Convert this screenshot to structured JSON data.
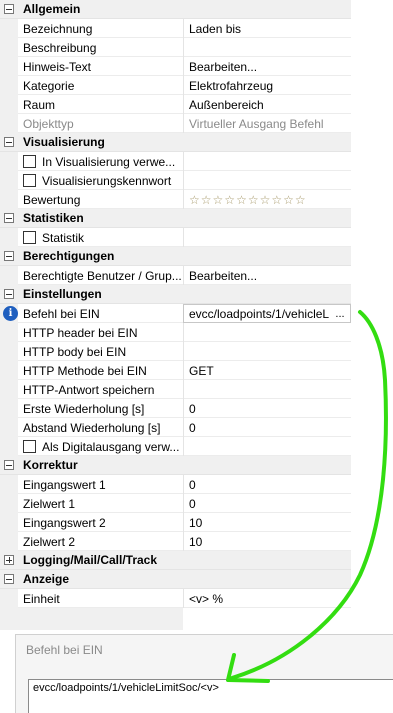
{
  "sections": [
    {
      "title": "Allgemein",
      "rows": [
        {
          "name": "Bezeichnung",
          "value": "Laden bis"
        },
        {
          "name": "Beschreibung",
          "value": ""
        },
        {
          "name": "Hinweis-Text",
          "value": "Bearbeiten..."
        },
        {
          "name": "Kategorie",
          "value": "Elektrofahrzeug"
        },
        {
          "name": "Raum",
          "value": "Außenbereich"
        },
        {
          "name": "Objekttyp",
          "value": "Virtueller Ausgang Befehl"
        }
      ]
    },
    {
      "title": "Visualisierung",
      "rows": [
        {
          "name": "In Visualisierung verwe...",
          "value": ""
        },
        {
          "name": "Visualisierungskennwort",
          "value": ""
        },
        {
          "name": "Bewertung",
          "value": ""
        }
      ]
    },
    {
      "title": "Statistiken",
      "rows": [
        {
          "name": "Statistik",
          "value": ""
        }
      ]
    },
    {
      "title": "Berechtigungen",
      "rows": [
        {
          "name": "Berechtigte Benutzer / Grup...",
          "value": "Bearbeiten..."
        }
      ]
    },
    {
      "title": "Einstellungen",
      "rows": [
        {
          "name": "Befehl bei EIN",
          "value": "evcc/loadpoints/1/vehicleL",
          "button": "..."
        },
        {
          "name": "HTTP header bei EIN",
          "value": ""
        },
        {
          "name": "HTTP body bei EIN",
          "value": ""
        },
        {
          "name": "HTTP Methode bei EIN",
          "value": "GET"
        },
        {
          "name": "HTTP-Antwort speichern",
          "value": ""
        },
        {
          "name": "Erste Wiederholung [s]",
          "value": "0"
        },
        {
          "name": "Abstand Wiederholung [s]",
          "value": "0"
        },
        {
          "name": "Als Digitalausgang verw...",
          "value": ""
        }
      ]
    },
    {
      "title": "Korrektur",
      "rows": [
        {
          "name": "Eingangswert 1",
          "value": "0"
        },
        {
          "name": "Zielwert 1",
          "value": "0"
        },
        {
          "name": "Eingangswert 2",
          "value": "10"
        },
        {
          "name": "Zielwert 2",
          "value": "10"
        }
      ]
    },
    {
      "title": "Logging/Mail/Call/Track",
      "rows": []
    },
    {
      "title": "Anzeige",
      "rows": [
        {
          "name": "Einheit",
          "value": "<v> %"
        }
      ]
    }
  ],
  "rating": {
    "stars": 10,
    "star_glyph": "☆",
    "filled": 0
  },
  "dialog": {
    "title": "Befehl bei EIN",
    "input_value": "evcc/loadpoints/1/vehicleLimitSoc/<v>"
  },
  "colors": {
    "category_bg": "#f0f0f0",
    "info_icon": "#1f5fbf",
    "annotation_arrow": "#33dd11",
    "muted_text": "#8a8a8a"
  }
}
